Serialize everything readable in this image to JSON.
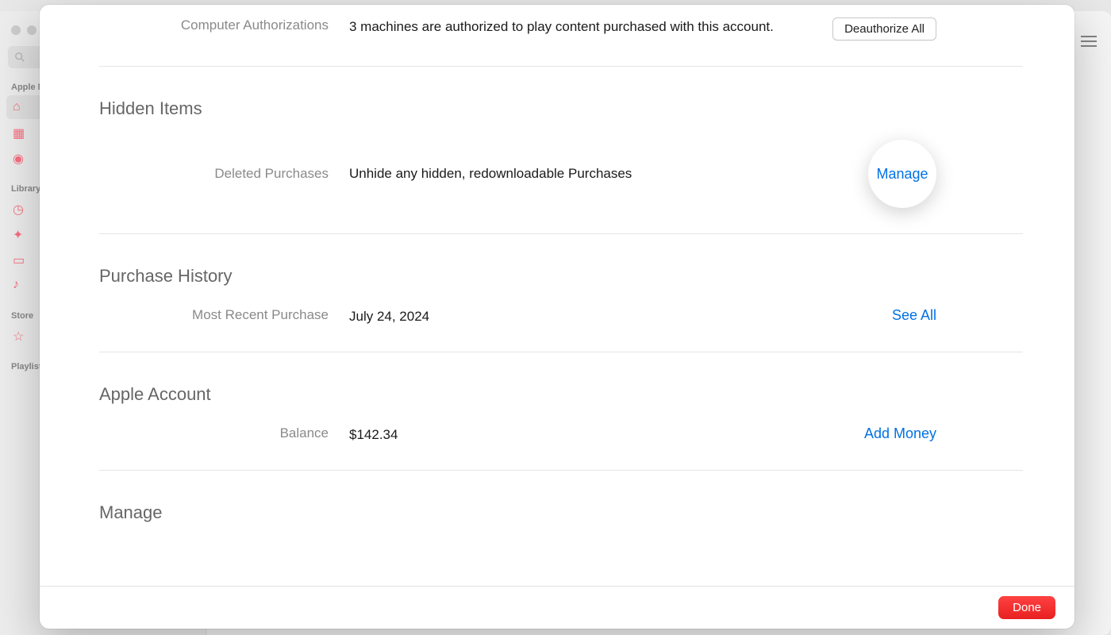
{
  "background": {
    "sidebar": {
      "section_apple": "Apple Music",
      "section_library": "Library",
      "section_store": "Store",
      "section_playlists": "Playlists"
    }
  },
  "modal": {
    "computer_auth": {
      "label": "Computer Authorizations",
      "value": "3 machines are authorized to play content purchased with this account.",
      "action": "Deauthorize All"
    },
    "hidden_items": {
      "title": "Hidden Items",
      "deleted_label": "Deleted Purchases",
      "deleted_value": "Unhide any hidden, redownloadable Purchases",
      "action": "Manage"
    },
    "purchase_history": {
      "title": "Purchase History",
      "recent_label": "Most Recent Purchase",
      "recent_value": "July 24, 2024",
      "action": "See All"
    },
    "apple_account": {
      "title": "Apple Account",
      "balance_label": "Balance",
      "balance_value": "$142.34",
      "action": "Add Money"
    },
    "manage": {
      "title": "Manage"
    },
    "footer": {
      "done": "Done"
    }
  }
}
